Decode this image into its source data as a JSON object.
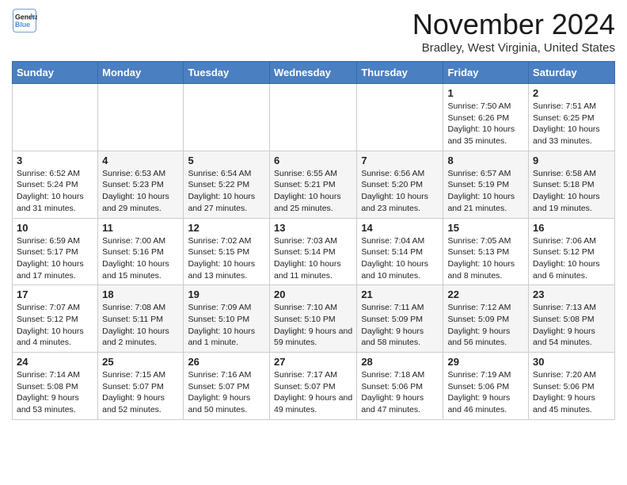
{
  "logo": {
    "line1": "General",
    "line2": "Blue"
  },
  "title": "November 2024",
  "location": "Bradley, West Virginia, United States",
  "days_of_week": [
    "Sunday",
    "Monday",
    "Tuesday",
    "Wednesday",
    "Thursday",
    "Friday",
    "Saturday"
  ],
  "weeks": [
    [
      {
        "day": "",
        "info": ""
      },
      {
        "day": "",
        "info": ""
      },
      {
        "day": "",
        "info": ""
      },
      {
        "day": "",
        "info": ""
      },
      {
        "day": "",
        "info": ""
      },
      {
        "day": "1",
        "info": "Sunrise: 7:50 AM\nSunset: 6:26 PM\nDaylight: 10 hours and 35 minutes."
      },
      {
        "day": "2",
        "info": "Sunrise: 7:51 AM\nSunset: 6:25 PM\nDaylight: 10 hours and 33 minutes."
      }
    ],
    [
      {
        "day": "3",
        "info": "Sunrise: 6:52 AM\nSunset: 5:24 PM\nDaylight: 10 hours and 31 minutes."
      },
      {
        "day": "4",
        "info": "Sunrise: 6:53 AM\nSunset: 5:23 PM\nDaylight: 10 hours and 29 minutes."
      },
      {
        "day": "5",
        "info": "Sunrise: 6:54 AM\nSunset: 5:22 PM\nDaylight: 10 hours and 27 minutes."
      },
      {
        "day": "6",
        "info": "Sunrise: 6:55 AM\nSunset: 5:21 PM\nDaylight: 10 hours and 25 minutes."
      },
      {
        "day": "7",
        "info": "Sunrise: 6:56 AM\nSunset: 5:20 PM\nDaylight: 10 hours and 23 minutes."
      },
      {
        "day": "8",
        "info": "Sunrise: 6:57 AM\nSunset: 5:19 PM\nDaylight: 10 hours and 21 minutes."
      },
      {
        "day": "9",
        "info": "Sunrise: 6:58 AM\nSunset: 5:18 PM\nDaylight: 10 hours and 19 minutes."
      }
    ],
    [
      {
        "day": "10",
        "info": "Sunrise: 6:59 AM\nSunset: 5:17 PM\nDaylight: 10 hours and 17 minutes."
      },
      {
        "day": "11",
        "info": "Sunrise: 7:00 AM\nSunset: 5:16 PM\nDaylight: 10 hours and 15 minutes."
      },
      {
        "day": "12",
        "info": "Sunrise: 7:02 AM\nSunset: 5:15 PM\nDaylight: 10 hours and 13 minutes."
      },
      {
        "day": "13",
        "info": "Sunrise: 7:03 AM\nSunset: 5:14 PM\nDaylight: 10 hours and 11 minutes."
      },
      {
        "day": "14",
        "info": "Sunrise: 7:04 AM\nSunset: 5:14 PM\nDaylight: 10 hours and 10 minutes."
      },
      {
        "day": "15",
        "info": "Sunrise: 7:05 AM\nSunset: 5:13 PM\nDaylight: 10 hours and 8 minutes."
      },
      {
        "day": "16",
        "info": "Sunrise: 7:06 AM\nSunset: 5:12 PM\nDaylight: 10 hours and 6 minutes."
      }
    ],
    [
      {
        "day": "17",
        "info": "Sunrise: 7:07 AM\nSunset: 5:12 PM\nDaylight: 10 hours and 4 minutes."
      },
      {
        "day": "18",
        "info": "Sunrise: 7:08 AM\nSunset: 5:11 PM\nDaylight: 10 hours and 2 minutes."
      },
      {
        "day": "19",
        "info": "Sunrise: 7:09 AM\nSunset: 5:10 PM\nDaylight: 10 hours and 1 minute."
      },
      {
        "day": "20",
        "info": "Sunrise: 7:10 AM\nSunset: 5:10 PM\nDaylight: 9 hours and 59 minutes."
      },
      {
        "day": "21",
        "info": "Sunrise: 7:11 AM\nSunset: 5:09 PM\nDaylight: 9 hours and 58 minutes."
      },
      {
        "day": "22",
        "info": "Sunrise: 7:12 AM\nSunset: 5:09 PM\nDaylight: 9 hours and 56 minutes."
      },
      {
        "day": "23",
        "info": "Sunrise: 7:13 AM\nSunset: 5:08 PM\nDaylight: 9 hours and 54 minutes."
      }
    ],
    [
      {
        "day": "24",
        "info": "Sunrise: 7:14 AM\nSunset: 5:08 PM\nDaylight: 9 hours and 53 minutes."
      },
      {
        "day": "25",
        "info": "Sunrise: 7:15 AM\nSunset: 5:07 PM\nDaylight: 9 hours and 52 minutes."
      },
      {
        "day": "26",
        "info": "Sunrise: 7:16 AM\nSunset: 5:07 PM\nDaylight: 9 hours and 50 minutes."
      },
      {
        "day": "27",
        "info": "Sunrise: 7:17 AM\nSunset: 5:07 PM\nDaylight: 9 hours and 49 minutes."
      },
      {
        "day": "28",
        "info": "Sunrise: 7:18 AM\nSunset: 5:06 PM\nDaylight: 9 hours and 47 minutes."
      },
      {
        "day": "29",
        "info": "Sunrise: 7:19 AM\nSunset: 5:06 PM\nDaylight: 9 hours and 46 minutes."
      },
      {
        "day": "30",
        "info": "Sunrise: 7:20 AM\nSunset: 5:06 PM\nDaylight: 9 hours and 45 minutes."
      }
    ]
  ]
}
